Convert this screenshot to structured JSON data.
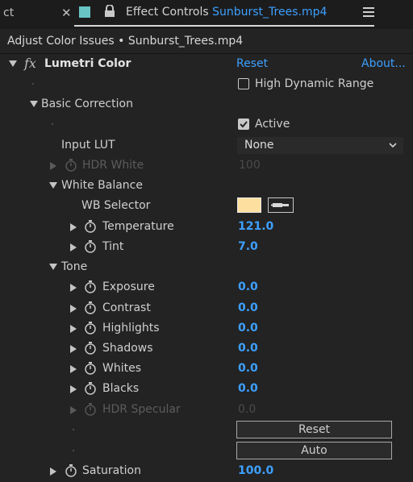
{
  "tab": {
    "partial_label": "ct",
    "close": "✕",
    "title": "Effect Controls",
    "file": "Sunburst_Trees.mp4"
  },
  "header": {
    "label": "Adjust Color Issues • Sunburst_Trees.mp4"
  },
  "effect": {
    "fx_glyph": "fx",
    "name": "Lumetri Color",
    "reset": "Reset",
    "about": "About...",
    "hdr_label": "High Dynamic Range",
    "hdr_checked": false
  },
  "basic": {
    "label": "Basic Correction",
    "active_label": "Active",
    "active_checked": true,
    "input_lut_label": "Input LUT",
    "input_lut_value": "None",
    "hdr_white_label": "HDR White",
    "hdr_white_value": "100",
    "white_balance": {
      "label": "White Balance",
      "wb_selector_label": "WB Selector",
      "wb_color": "#fde0a0",
      "temperature_label": "Temperature",
      "temperature_value": "121.0",
      "tint_label": "Tint",
      "tint_value": "7.0"
    },
    "tone": {
      "label": "Tone",
      "exposure_label": "Exposure",
      "exposure_value": "0.0",
      "contrast_label": "Contrast",
      "contrast_value": "0.0",
      "highlights_label": "Highlights",
      "highlights_value": "0.0",
      "shadows_label": "Shadows",
      "shadows_value": "0.0",
      "whites_label": "Whites",
      "whites_value": "0.0",
      "blacks_label": "Blacks",
      "blacks_value": "0.0",
      "hdr_specular_label": "HDR Specular",
      "hdr_specular_value": "0.0",
      "reset_button": "Reset",
      "auto_button": "Auto"
    },
    "saturation_label": "Saturation",
    "saturation_value": "100.0"
  },
  "colors": {
    "accent": "#3da0ff",
    "background": "#232323",
    "swatch_tab": "#68c5c4"
  }
}
